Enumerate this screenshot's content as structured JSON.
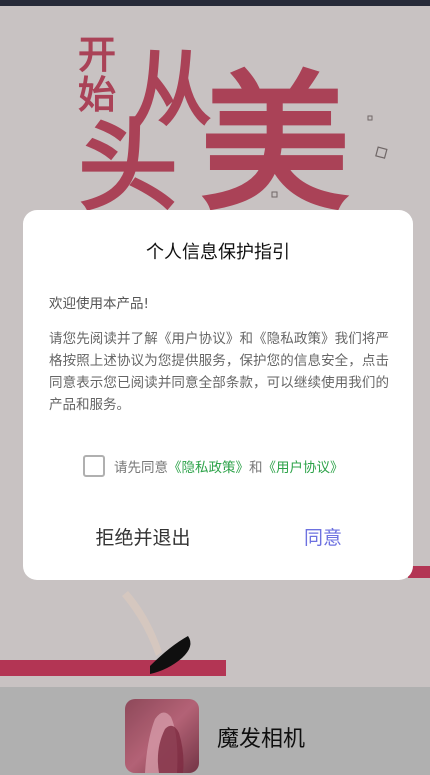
{
  "splash": {
    "slogan_small_1": "开",
    "slogan_small_2": "始",
    "slogan_big_1": "从",
    "slogan_big_2": "头",
    "slogan_big_3": "美"
  },
  "dialog": {
    "title": "个人信息保护指引",
    "welcome": "欢迎使用本产品!",
    "body": "请您先阅读并了解《用户协议》和《隐私政策》我们将严格按照上述协议为您提供服务，保护您的信息安全，点击同意表示您已阅读并同意全部条款，可以继续使用我们的产品和服务。",
    "consent_prefix": "请先同意",
    "privacy_link": "《隐私政策》",
    "consent_and": "和",
    "agreement_link": "《用户协议》",
    "consent_checked": false,
    "reject_label": "拒绝并退出",
    "agree_label": "同意"
  },
  "footer": {
    "app_name": "魔发相机"
  },
  "colors": {
    "accent": "#6d71e0",
    "link": "#2ea34a",
    "brand": "#c33a5c"
  }
}
